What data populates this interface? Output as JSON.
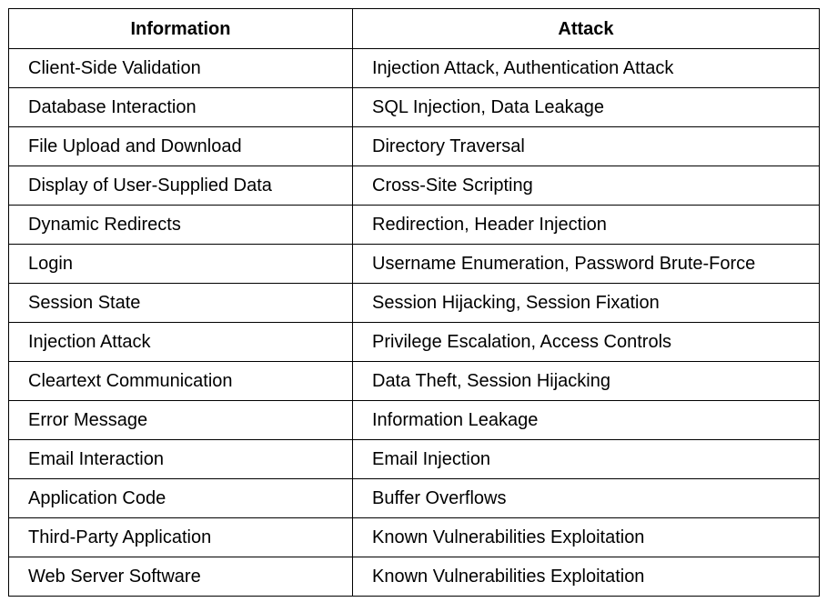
{
  "table": {
    "headers": [
      "Information",
      "Attack"
    ],
    "rows": [
      [
        "Client-Side Validation",
        "Injection Attack, Authentication Attack"
      ],
      [
        "Database Interaction",
        "SQL Injection, Data Leakage"
      ],
      [
        "File Upload and Download",
        "Directory Traversal"
      ],
      [
        "Display of User-Supplied Data",
        "Cross-Site Scripting"
      ],
      [
        "Dynamic Redirects",
        "Redirection, Header Injection"
      ],
      [
        "Login",
        "Username Enumeration, Password Brute-Force"
      ],
      [
        "Session State",
        "Session Hijacking, Session Fixation"
      ],
      [
        "Injection Attack",
        "Privilege Escalation, Access Controls"
      ],
      [
        "Cleartext Communication",
        "Data Theft, Session Hijacking"
      ],
      [
        "Error Message",
        "Information Leakage"
      ],
      [
        "Email Interaction",
        "Email Injection"
      ],
      [
        "Application Code",
        "Buffer Overflows"
      ],
      [
        "Third-Party Application",
        "Known Vulnerabilities Exploitation"
      ],
      [
        "Web Server Software",
        "Known Vulnerabilities Exploitation"
      ]
    ]
  }
}
